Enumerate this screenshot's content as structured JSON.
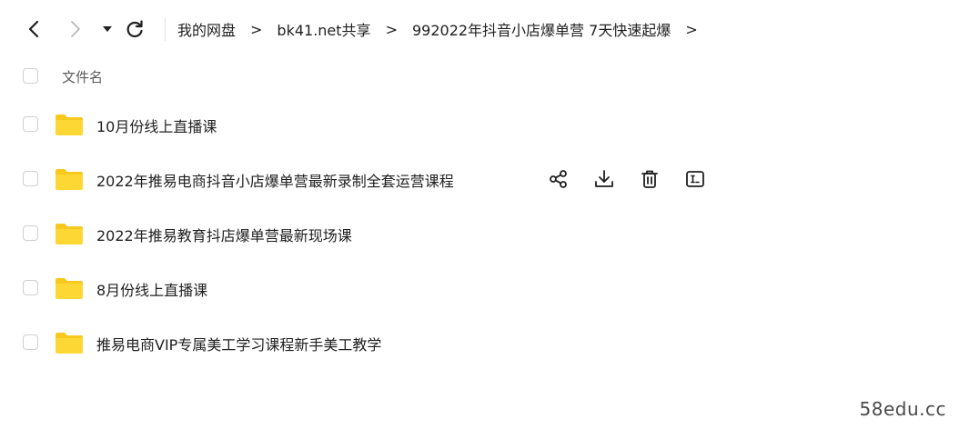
{
  "nav": {
    "back_icon": "chevron-left-icon",
    "forward_icon": "chevron-right-icon",
    "dropdown_icon": "caret-down-icon",
    "refresh_icon": "refresh-icon"
  },
  "breadcrumb": {
    "items": [
      "我的网盘",
      "bk41.net共享",
      "992022年抖音小店爆单营 7天快速起爆"
    ],
    "separator": ">"
  },
  "file_list": {
    "header": "文件名",
    "rows": [
      {
        "name": "10月份线上直播课",
        "type": "folder"
      },
      {
        "name": "2022年推易电商抖音小店爆单营最新录制全套运营课程",
        "type": "folder",
        "hovered": true
      },
      {
        "name": "2022年推易教育抖店爆单营最新现场课",
        "type": "folder"
      },
      {
        "name": "8月份线上直播课",
        "type": "folder"
      },
      {
        "name": "推易电商VIP专属美工学习课程新手美工教学",
        "type": "folder"
      }
    ],
    "row_actions": [
      "share-icon",
      "download-icon",
      "delete-icon",
      "rename-icon"
    ]
  },
  "colors": {
    "folder": "#fdd835",
    "folder_tab": "#f7c81e",
    "text": "#1f1f1f",
    "muted": "#5b5b5b",
    "checkbox_border": "#cfcfcf"
  },
  "watermark": "58edu.cc"
}
